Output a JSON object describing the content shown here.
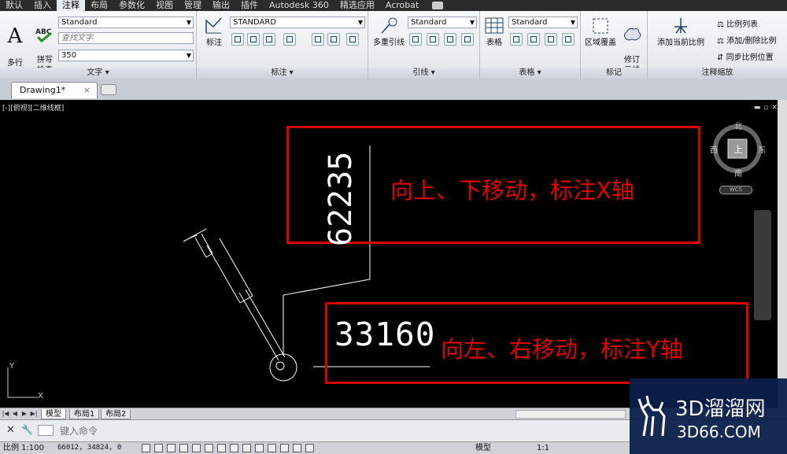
{
  "menu": [
    "默认",
    "插入",
    "注释",
    "布局",
    "参数化",
    "视图",
    "管理",
    "输出",
    "插件",
    "Autodesk 360",
    "精选应用",
    "Acrobat"
  ],
  "active_menu_index": 2,
  "ribbon": {
    "text_group": {
      "footer": "文字",
      "multiline_text": "多行\n文字",
      "spell_check": "拼写\n检查",
      "style_value": "Standard",
      "find_placeholder": "查找文字",
      "height_value": "350"
    },
    "dim_group": {
      "footer": "标注",
      "dimension": "标注",
      "style_value": "STANDARD"
    },
    "leader_group": {
      "footer": "引线",
      "multileader": "多重引线",
      "style_value": "Standard"
    },
    "table_group": {
      "footer": "表格",
      "table": "表格",
      "style_value": "Standard"
    },
    "markup_group": {
      "footer": "标记",
      "wipeout": "区域覆盖",
      "revcloud": "修订\n云线"
    },
    "annoscale_group": {
      "footer": "注释缩放",
      "add_current": "添加当前比例",
      "scale_list": "比例列表",
      "add_delete": "添加/删除比例",
      "sync": "同步比例位置"
    }
  },
  "document_tab": "Drawing1*",
  "viewport_label": "[-][俯视][二维线框]",
  "annotations": {
    "box1_text": "向上、下移动，标注X轴",
    "box2_text": "向左、右移动，标注Y轴",
    "dim_x_value": "62235",
    "dim_y_value": "33160"
  },
  "viewcube": {
    "north": "北",
    "south": "南",
    "east": "东",
    "west": "西",
    "top": "上",
    "wcs": "WCS"
  },
  "ucs": {
    "x": "X",
    "y": "Y"
  },
  "layout_tabs": [
    "模型",
    "布局1",
    "布局2"
  ],
  "command": {
    "placeholder": "键入命令"
  },
  "status": {
    "scale": "比例 1:100",
    "coords": "66012, 34824, 0",
    "model": "模型",
    "anno_scale": "1:1"
  },
  "watermark": {
    "name": "3D溜溜网",
    "site": "3D66.COM"
  }
}
